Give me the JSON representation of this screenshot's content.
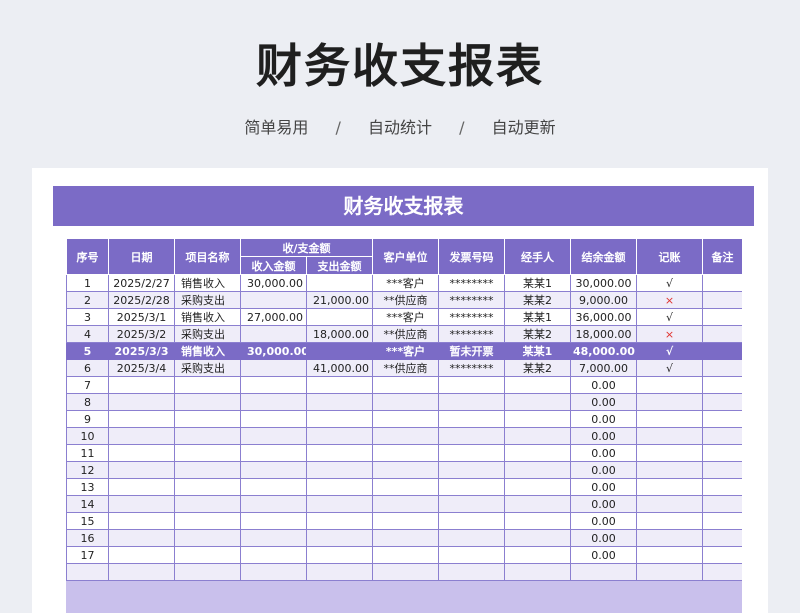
{
  "page": {
    "title": "财务收支报表",
    "features": [
      "简单易用",
      "自动统计",
      "自动更新"
    ],
    "separator": "/"
  },
  "sheet": {
    "banner_title": "财务收支报表",
    "headers": {
      "seq": "序号",
      "date": "日期",
      "item": "项目名称",
      "amount_group": "收/支金额",
      "income": "收入金额",
      "expense": "支出金额",
      "client": "客户单位",
      "invoice": "发票号码",
      "handler": "经手人",
      "balance": "结余金额",
      "booked": "记账",
      "note": "备注"
    },
    "rows": [
      {
        "seq": "1",
        "date": "2025/2/27",
        "item": "销售收入",
        "income": "30,000.00",
        "expense": "",
        "client": "***客户",
        "invoice": "********",
        "handler": "某某1",
        "balance": "30,000.00",
        "booked": "√",
        "note": ""
      },
      {
        "seq": "2",
        "date": "2025/2/28",
        "item": "采购支出",
        "income": "",
        "expense": "21,000.00",
        "client": "**供应商",
        "invoice": "********",
        "handler": "某某2",
        "balance": "9,000.00",
        "booked": "×",
        "note": ""
      },
      {
        "seq": "3",
        "date": "2025/3/1",
        "item": "销售收入",
        "income": "27,000.00",
        "expense": "",
        "client": "***客户",
        "invoice": "********",
        "handler": "某某1",
        "balance": "36,000.00",
        "booked": "√",
        "note": ""
      },
      {
        "seq": "4",
        "date": "2025/3/2",
        "item": "采购支出",
        "income": "",
        "expense": "18,000.00",
        "client": "**供应商",
        "invoice": "********",
        "handler": "某某2",
        "balance": "18,000.00",
        "booked": "×",
        "note": ""
      },
      {
        "seq": "5",
        "date": "2025/3/3",
        "item": "销售收入",
        "income": "30,000.00",
        "expense": "",
        "client": "***客户",
        "invoice": "暂未开票",
        "handler": "某某1",
        "balance": "48,000.00",
        "booked": "√",
        "note": "",
        "highlight": true
      },
      {
        "seq": "6",
        "date": "2025/3/4",
        "item": "采购支出",
        "income": "",
        "expense": "41,000.00",
        "client": "**供应商",
        "invoice": "********",
        "handler": "某某2",
        "balance": "7,000.00",
        "booked": "√",
        "note": ""
      },
      {
        "seq": "7",
        "date": "",
        "item": "",
        "income": "",
        "expense": "",
        "client": "",
        "invoice": "",
        "handler": "",
        "balance": "0.00",
        "booked": "",
        "note": ""
      },
      {
        "seq": "8",
        "date": "",
        "item": "",
        "income": "",
        "expense": "",
        "client": "",
        "invoice": "",
        "handler": "",
        "balance": "0.00",
        "booked": "",
        "note": ""
      },
      {
        "seq": "9",
        "date": "",
        "item": "",
        "income": "",
        "expense": "",
        "client": "",
        "invoice": "",
        "handler": "",
        "balance": "0.00",
        "booked": "",
        "note": ""
      },
      {
        "seq": "10",
        "date": "",
        "item": "",
        "income": "",
        "expense": "",
        "client": "",
        "invoice": "",
        "handler": "",
        "balance": "0.00",
        "booked": "",
        "note": ""
      },
      {
        "seq": "11",
        "date": "",
        "item": "",
        "income": "",
        "expense": "",
        "client": "",
        "invoice": "",
        "handler": "",
        "balance": "0.00",
        "booked": "",
        "note": ""
      },
      {
        "seq": "12",
        "date": "",
        "item": "",
        "income": "",
        "expense": "",
        "client": "",
        "invoice": "",
        "handler": "",
        "balance": "0.00",
        "booked": "",
        "note": ""
      },
      {
        "seq": "13",
        "date": "",
        "item": "",
        "income": "",
        "expense": "",
        "client": "",
        "invoice": "",
        "handler": "",
        "balance": "0.00",
        "booked": "",
        "note": ""
      },
      {
        "seq": "14",
        "date": "",
        "item": "",
        "income": "",
        "expense": "",
        "client": "",
        "invoice": "",
        "handler": "",
        "balance": "0.00",
        "booked": "",
        "note": ""
      },
      {
        "seq": "15",
        "date": "",
        "item": "",
        "income": "",
        "expense": "",
        "client": "",
        "invoice": "",
        "handler": "",
        "balance": "0.00",
        "booked": "",
        "note": ""
      },
      {
        "seq": "16",
        "date": "",
        "item": "",
        "income": "",
        "expense": "",
        "client": "",
        "invoice": "",
        "handler": "",
        "balance": "0.00",
        "booked": "",
        "note": ""
      },
      {
        "seq": "17",
        "date": "",
        "item": "",
        "income": "",
        "expense": "",
        "client": "",
        "invoice": "",
        "handler": "",
        "balance": "0.00",
        "booked": "",
        "note": ""
      },
      {
        "seq": "",
        "date": "",
        "item": "",
        "income": "",
        "expense": "",
        "client": "",
        "invoice": "",
        "handler": "",
        "balance": "",
        "booked": "",
        "note": ""
      }
    ]
  },
  "colors": {
    "accent": "#7b6bc6",
    "stripe": "#efedf9",
    "cross": "#e0332f",
    "page_bg": "#eceef3"
  }
}
